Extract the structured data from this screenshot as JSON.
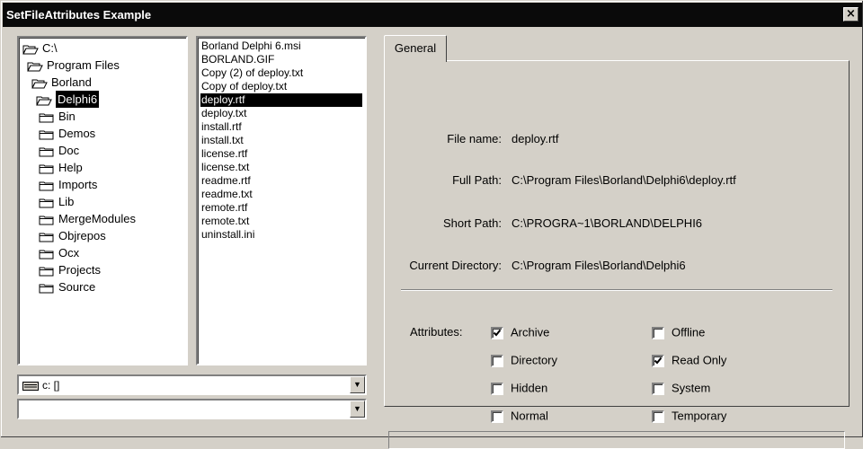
{
  "window": {
    "title": "SetFileAttributes Example",
    "close_glyph": "×"
  },
  "dir_tree": {
    "items": [
      {
        "label": "C:\\",
        "icon": "open-folder-icon",
        "level": 0,
        "selected": false
      },
      {
        "label": "Program Files",
        "icon": "open-folder-icon",
        "level": 1,
        "selected": false
      },
      {
        "label": "Borland",
        "icon": "open-folder-icon",
        "level": 2,
        "selected": false
      },
      {
        "label": "Delphi6",
        "icon": "open-folder-icon",
        "level": 3,
        "selected": true
      },
      {
        "label": "Bin",
        "icon": "folder-icon",
        "level": 4,
        "selected": false
      },
      {
        "label": "Demos",
        "icon": "folder-icon",
        "level": 4,
        "selected": false
      },
      {
        "label": "Doc",
        "icon": "folder-icon",
        "level": 4,
        "selected": false
      },
      {
        "label": "Help",
        "icon": "folder-icon",
        "level": 4,
        "selected": false
      },
      {
        "label": "Imports",
        "icon": "folder-icon",
        "level": 4,
        "selected": false
      },
      {
        "label": "Lib",
        "icon": "folder-icon",
        "level": 4,
        "selected": false
      },
      {
        "label": "MergeModules",
        "icon": "folder-icon",
        "level": 4,
        "selected": false
      },
      {
        "label": "Objrepos",
        "icon": "folder-icon",
        "level": 4,
        "selected": false
      },
      {
        "label": "Ocx",
        "icon": "folder-icon",
        "level": 4,
        "selected": false
      },
      {
        "label": "Projects",
        "icon": "folder-icon",
        "level": 4,
        "selected": false
      },
      {
        "label": "Source",
        "icon": "folder-icon",
        "level": 4,
        "selected": false
      }
    ]
  },
  "file_list": {
    "items": [
      "Borland Delphi 6.msi",
      "BORLAND.GIF",
      "Copy (2) of deploy.txt",
      "Copy of deploy.txt",
      "deploy.rtf",
      "deploy.txt",
      "install.rtf",
      "install.txt",
      "license.rtf",
      "license.txt",
      "readme.rtf",
      "readme.txt",
      "remote.rtf",
      "remote.txt",
      "uninstall.ini"
    ],
    "selected": "deploy.rtf"
  },
  "drive_combo": {
    "value": "c: []",
    "icon": "drive-icon",
    "dropdown_glyph": "▼"
  },
  "filter_combo": {
    "value": "",
    "dropdown_glyph": "▼"
  },
  "tabs": {
    "general_label": "General"
  },
  "fields": {
    "file_name_label": "File name:",
    "file_name_value": "deploy.rtf",
    "full_path_label": "Full Path:",
    "full_path_value": "C:\\Program Files\\Borland\\Delphi6\\deploy.rtf",
    "short_path_label": "Short Path:",
    "short_path_value": "C:\\PROGRA~1\\BORLAND\\DELPHI6",
    "current_dir_label": "Current Directory:",
    "current_dir_value": "C:\\Program Files\\Borland\\Delphi6"
  },
  "attributes": {
    "label": "Attributes:",
    "items": [
      {
        "name": "archive",
        "label": "Archive",
        "checked": true
      },
      {
        "name": "directory",
        "label": "Directory",
        "checked": false
      },
      {
        "name": "hidden",
        "label": "Hidden",
        "checked": false
      },
      {
        "name": "normal",
        "label": "Normal",
        "checked": false
      },
      {
        "name": "offline",
        "label": "Offline",
        "checked": false
      },
      {
        "name": "read-only",
        "label": "Read Only",
        "checked": true
      },
      {
        "name": "system",
        "label": "System",
        "checked": false
      },
      {
        "name": "temporary",
        "label": "Temporary",
        "checked": false
      }
    ]
  }
}
